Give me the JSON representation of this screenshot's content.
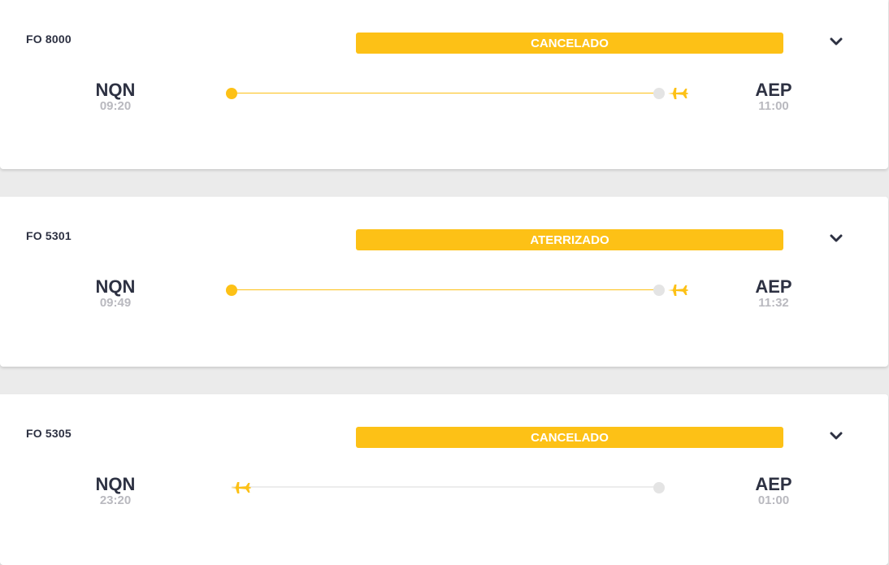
{
  "colors": {
    "accent": "#fdc116",
    "text_dark": "#2d3142",
    "text_muted": "#b9b9bf",
    "track_empty": "#ececec"
  },
  "icons": {
    "chevron": "chevron-down-icon",
    "plane": "airplane-icon"
  },
  "flights": [
    {
      "number": "FO 8000",
      "status": "CANCELADO",
      "origin": {
        "code": "NQN",
        "time": "09:20"
      },
      "destination": {
        "code": "AEP",
        "time": "11:00"
      },
      "progress": 1.0
    },
    {
      "number": "FO 5301",
      "status": "ATERRIZADO",
      "origin": {
        "code": "NQN",
        "time": "09:49"
      },
      "destination": {
        "code": "AEP",
        "time": "11:32"
      },
      "progress": 1.0
    },
    {
      "number": "FO 5305",
      "status": "CANCELADO",
      "origin": {
        "code": "NQN",
        "time": "23:20"
      },
      "destination": {
        "code": "AEP",
        "time": "01:00"
      },
      "progress": 0.0
    }
  ]
}
